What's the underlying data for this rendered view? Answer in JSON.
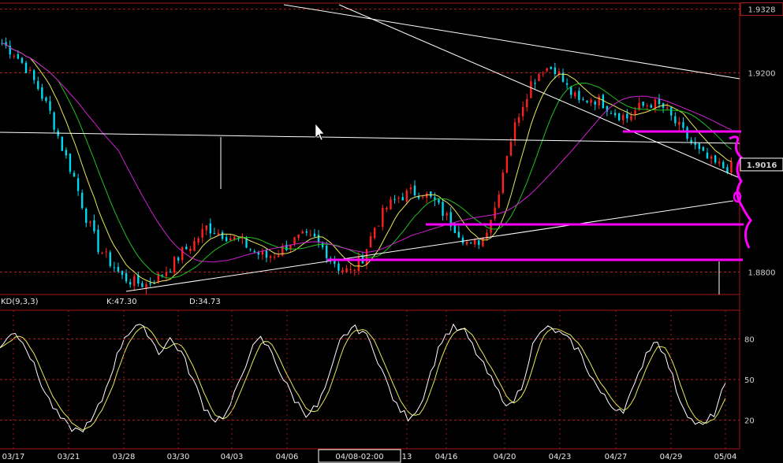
{
  "chart_data": {
    "type": "candlestick",
    "main_panel": {
      "price_axis": {
        "ticks": [
          {
            "value": 1.9328,
            "label": "1.9328",
            "boxed": true
          },
          {
            "value": 1.92,
            "label": "1.9200"
          },
          {
            "value": 1.9016,
            "label": "1.9016",
            "boxed": true,
            "current": true
          },
          {
            "value": 1.88,
            "label": "1.8800"
          }
        ],
        "range": [
          1.8755,
          1.934
        ]
      },
      "series": [
        {
          "name": "",
          "type": "candles",
          "up_color": "#ff2020",
          "down_color": "#00d8f0"
        },
        {
          "name": "",
          "type": "ma",
          "color": "#e8e858"
        },
        {
          "name": "",
          "type": "ma",
          "color": "#20c020"
        },
        {
          "name": "",
          "type": "ma",
          "color": "#d020d0"
        }
      ],
      "closes_sketch": [
        1.926,
        1.924,
        1.921,
        1.917,
        1.912,
        1.905,
        1.899,
        1.891,
        1.885,
        1.882,
        1.879,
        1.878,
        1.8775,
        1.879,
        1.881,
        1.884,
        1.886,
        1.889,
        1.888,
        1.887,
        1.886,
        1.884,
        1.883,
        1.884,
        1.886,
        1.887,
        1.8865,
        1.884,
        1.881,
        1.88,
        1.883,
        1.889,
        1.893,
        1.895,
        1.896,
        1.896,
        1.894,
        1.891,
        1.888,
        1.885,
        1.887,
        1.893,
        1.904,
        1.912,
        1.918,
        1.921,
        1.921,
        1.917,
        1.914,
        1.915,
        1.914,
        1.912,
        1.911,
        1.913,
        1.914,
        1.913,
        1.91,
        1.907,
        1.904,
        1.902,
        1.901
      ],
      "drawings": [
        {
          "kind": "trendline",
          "color": "#ffffff"
        },
        {
          "kind": "trendline",
          "color": "#ffffff"
        },
        {
          "kind": "trendline",
          "color": "#ffffff"
        },
        {
          "kind": "trendline",
          "color": "#ffffff"
        },
        {
          "kind": "support",
          "color": "#ff00ff"
        },
        {
          "kind": "support",
          "color": "#ff00ff"
        },
        {
          "kind": "resistance",
          "color": "#ff00ff"
        },
        {
          "kind": "freehand",
          "color": "#ff00ff"
        }
      ]
    },
    "indicator_panel": {
      "name": "KD(9,3,3)",
      "values": [
        {
          "label": "K:47.30"
        },
        {
          "label": "D:34.73"
        }
      ],
      "y_ticks": [
        80,
        50,
        20
      ],
      "range": [
        0,
        100
      ],
      "k_color": "#ffffff",
      "d_color": "#e8e858",
      "k_sketch": [
        75,
        85,
        80,
        60,
        40,
        25,
        15,
        12,
        18,
        35,
        60,
        82,
        90,
        85,
        70,
        80,
        70,
        50,
        30,
        20,
        25,
        45,
        70,
        80,
        70,
        50,
        35,
        25,
        30,
        50,
        78,
        88,
        86,
        72,
        50,
        30,
        22,
        30,
        55,
        80,
        88,
        85,
        70,
        55,
        40,
        30,
        45,
        75,
        88,
        86,
        80,
        72,
        55,
        40,
        30,
        28,
        45,
        70,
        80,
        60,
        35,
        20,
        15,
        25,
        47.3
      ]
    },
    "x_axis": {
      "ticks": [
        "03/17",
        "03/21",
        "03/28",
        "03/30",
        "04/03",
        "04/06",
        "13",
        "04/16",
        "04/20",
        "04/23",
        "04/27",
        "04/29",
        "05/04"
      ],
      "cursor_label": "04/08-02:00"
    }
  }
}
